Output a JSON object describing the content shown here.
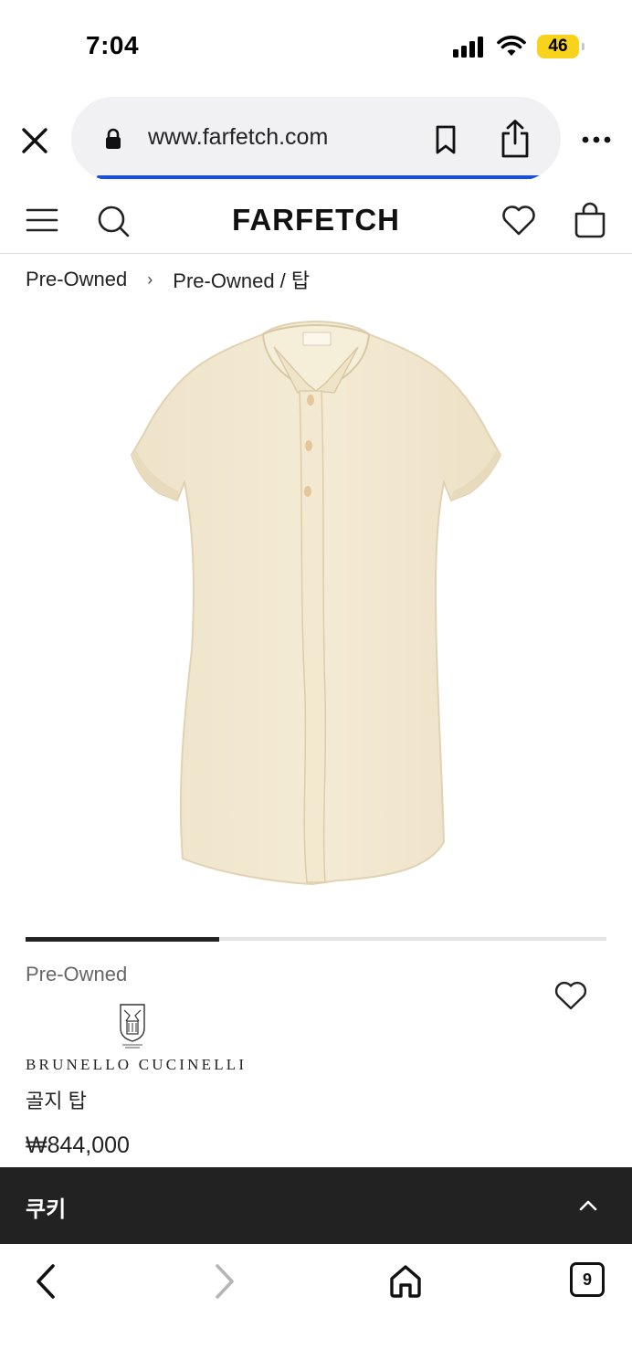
{
  "status_bar": {
    "time": "7:04",
    "battery_level": "46",
    "battery_color": "#f8d31c",
    "icons": [
      "signal-icon",
      "wifi-icon",
      "battery-icon"
    ]
  },
  "browser": {
    "url": "www.farfetch.com",
    "progress_color": "#1a4fd3",
    "icons": [
      "close-icon",
      "lock-icon",
      "bookmark-icon",
      "share-icon",
      "more-icon"
    ]
  },
  "site_header": {
    "logo": "FARFETCH",
    "icons": [
      "menu-icon",
      "search-icon",
      "heart-icon",
      "bag-icon"
    ]
  },
  "breadcrumb": {
    "items": [
      "Pre-Owned",
      "Pre-Owned / 탑"
    ],
    "separator": "›"
  },
  "carousel": {
    "current_fraction": 0.333
  },
  "product": {
    "condition_label": "Pre-Owned",
    "brand": "BRUNELLO CUCINELLI",
    "name": "골지 탑",
    "price": "₩844,000",
    "garment_color": "#f1e7cf"
  },
  "cookie_bar": {
    "title": "쿠키",
    "background": "#222222"
  },
  "toolbar": {
    "tab_count": "9",
    "icons": [
      "back-icon",
      "forward-icon",
      "home-icon",
      "tabs-icon"
    ]
  }
}
